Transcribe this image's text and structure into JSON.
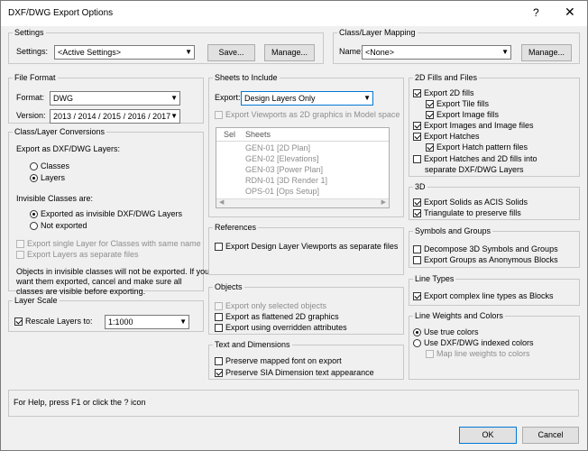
{
  "window": {
    "title": "DXF/DWG Export Options",
    "help": "?",
    "close": "✕"
  },
  "settings": {
    "title": "Settings",
    "label": "Settings:",
    "value": "<Active Settings>",
    "save": "Save...",
    "manage": "Manage..."
  },
  "mapping": {
    "title": "Class/Layer Mapping",
    "label": "Name:",
    "value": "<None>",
    "manage": "Manage..."
  },
  "file_format": {
    "title": "File Format",
    "format_label": "Format:",
    "format_value": "DWG",
    "version_label": "Version:",
    "version_value": "2013 / 2014 / 2015 / 2016 / 2017"
  },
  "class_layer": {
    "title": "Class/Layer Conversions",
    "export_as": "Export as DXF/DWG Layers:",
    "opt_classes": "Classes",
    "opt_layers": "Layers",
    "selected": "Layers",
    "invisible_label": "Invisible Classes are:",
    "opt_exported_invisible": "Exported as invisible DXF/DWG Layers",
    "opt_not_exported": "Not exported",
    "invisible_selected": "Exported as invisible DXF/DWG Layers",
    "single_layer": "Export single Layer for Classes with same name",
    "layers_separate": "Export Layers as separate files",
    "note": [
      "Objects in invisible classes will not be exported. If you",
      "want them exported, cancel and make sure all",
      "classes are visible before exporting."
    ]
  },
  "layer_scale": {
    "title": "Layer Scale",
    "rescale": "Rescale Layers to:",
    "rescale_checked": true,
    "value": "1:1000"
  },
  "sheets": {
    "title": "Sheets to Include",
    "export_label": "Export:",
    "export_value": "Design Layers Only",
    "viewports_2d": "Export Viewports as 2D graphics in Model space",
    "col_sel": "Sel",
    "col_sheets": "Sheets",
    "rows": [
      "GEN-01 [2D Plan]",
      "GEN-02 [Elevations]",
      "GEN-03 [Power Plan]",
      "RDN-01 [3D Render 1]",
      "OPS-01 [Ops Setup]"
    ]
  },
  "references": {
    "title": "References",
    "viewports_separate": "Export Design Layer Viewports as separate files",
    "checked": false
  },
  "objects": {
    "title": "Objects",
    "selected_only": "Export only selected objects",
    "flattened": "Export as flattened 2D graphics",
    "overridden": "Export using overridden attributes"
  },
  "text_dims": {
    "title": "Text and Dimensions",
    "mapped_font": "Preserve mapped font on export",
    "mapped_font_checked": false,
    "sia": "Preserve SIA Dimension text appearance",
    "sia_checked": true
  },
  "fills": {
    "title": "2D Fills and Files",
    "export_2d": "Export 2D fills",
    "tile": "Export Tile fills",
    "image": "Export Image fills",
    "images_files": "Export Images and Image files",
    "hatches": "Export Hatches",
    "hatch_pattern": "Export Hatch pattern files",
    "hatches_2d_line1": "Export Hatches and 2D fills into",
    "hatches_2d_line2": "separate DXF/DWG Layers"
  },
  "three_d": {
    "title": "3D",
    "acis": "Export Solids as ACIS Solids",
    "triangulate": "Triangulate to preserve fills"
  },
  "symbols": {
    "title": "Symbols and Groups",
    "decompose": "Decompose 3D Symbols and Groups",
    "anonymous": "Export Groups as Anonymous Blocks"
  },
  "line_types": {
    "title": "Line Types",
    "complex": "Export complex line types as Blocks"
  },
  "line_weights": {
    "title": "Line Weights and Colors",
    "true_colors": "Use true colors",
    "indexed": "Use DXF/DWG indexed colors",
    "map_weights": "Map line weights to colors",
    "selected": "Use true colors"
  },
  "help_text": "For Help, press F1 or click the ? icon",
  "buttons": {
    "ok": "OK",
    "cancel": "Cancel"
  }
}
